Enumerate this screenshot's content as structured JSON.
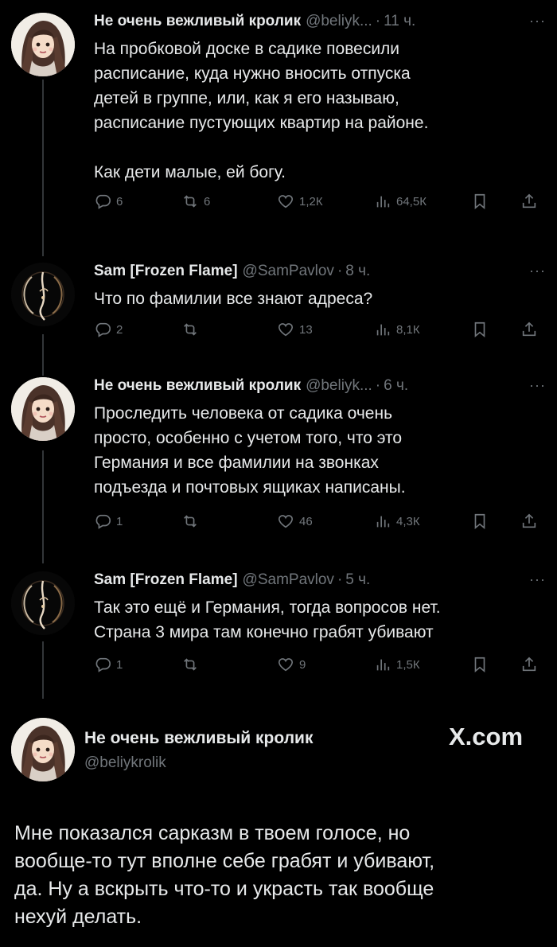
{
  "tweets": [
    {
      "name": "Не очень вежливый кролик",
      "handle": "@beliyk...",
      "time": "11 ч.",
      "lines": [
        "На пробковой доске в садике повесили",
        "расписание, куда нужно вносить отпуска",
        "детей в группе, или, как я его называю,",
        "расписание пустующих квартир на районе."
      ],
      "lines2": [
        "Как дети малые, ей богу."
      ],
      "replies": "6",
      "reposts": "6",
      "likes": "1,2К",
      "views": "64,5К"
    },
    {
      "name": "Sam [Frozen Flame]",
      "handle": "@SamPavlov",
      "time": "8 ч.",
      "lines": [
        "Что по фамилии все знают адреса?"
      ],
      "replies": "2",
      "reposts": "",
      "likes": "13",
      "views": "8,1К"
    },
    {
      "name": "Не очень вежливый кролик",
      "handle": "@beliyk...",
      "time": "6 ч.",
      "lines": [
        "Проследить человека от садика очень",
        "просто, особенно с учетом того, что это",
        "Германия и все фамилии на звонках",
        "подъезда и почтовых ящиках написаны."
      ],
      "replies": "1",
      "reposts": "",
      "likes": "46",
      "views": "4,3К"
    },
    {
      "name": "Sam [Frozen Flame]",
      "handle": "@SamPavlov",
      "time": "5 ч.",
      "lines": [
        "Так это ещё и Германия, тогда вопросов нет.",
        "Страна 3 мира там конечно грабят убивают"
      ],
      "replies": "1",
      "reposts": "",
      "likes": "9",
      "views": "1,5К"
    }
  ],
  "main": {
    "name": "Не очень вежливый кролик",
    "handle": "@beliykrolik",
    "watermark": "X.com",
    "lines": [
      "Мне показался сарказм в твоем голосе, но",
      "вообще-то тут вполне себе грабят и убивают,",
      "да. Ну а вскрыть что-то и украсть так вообще",
      "нехуй делать."
    ]
  },
  "icons": {
    "reply": "reply-icon",
    "repost": "repost-icon",
    "like": "heart-icon",
    "views": "views-icon",
    "bookmark": "bookmark-icon",
    "share": "share-icon",
    "more": "more-icon"
  },
  "colors": {
    "background": "#000000",
    "text": "#e7e9ea",
    "muted": "#71767b",
    "thread_line": "#333639"
  }
}
